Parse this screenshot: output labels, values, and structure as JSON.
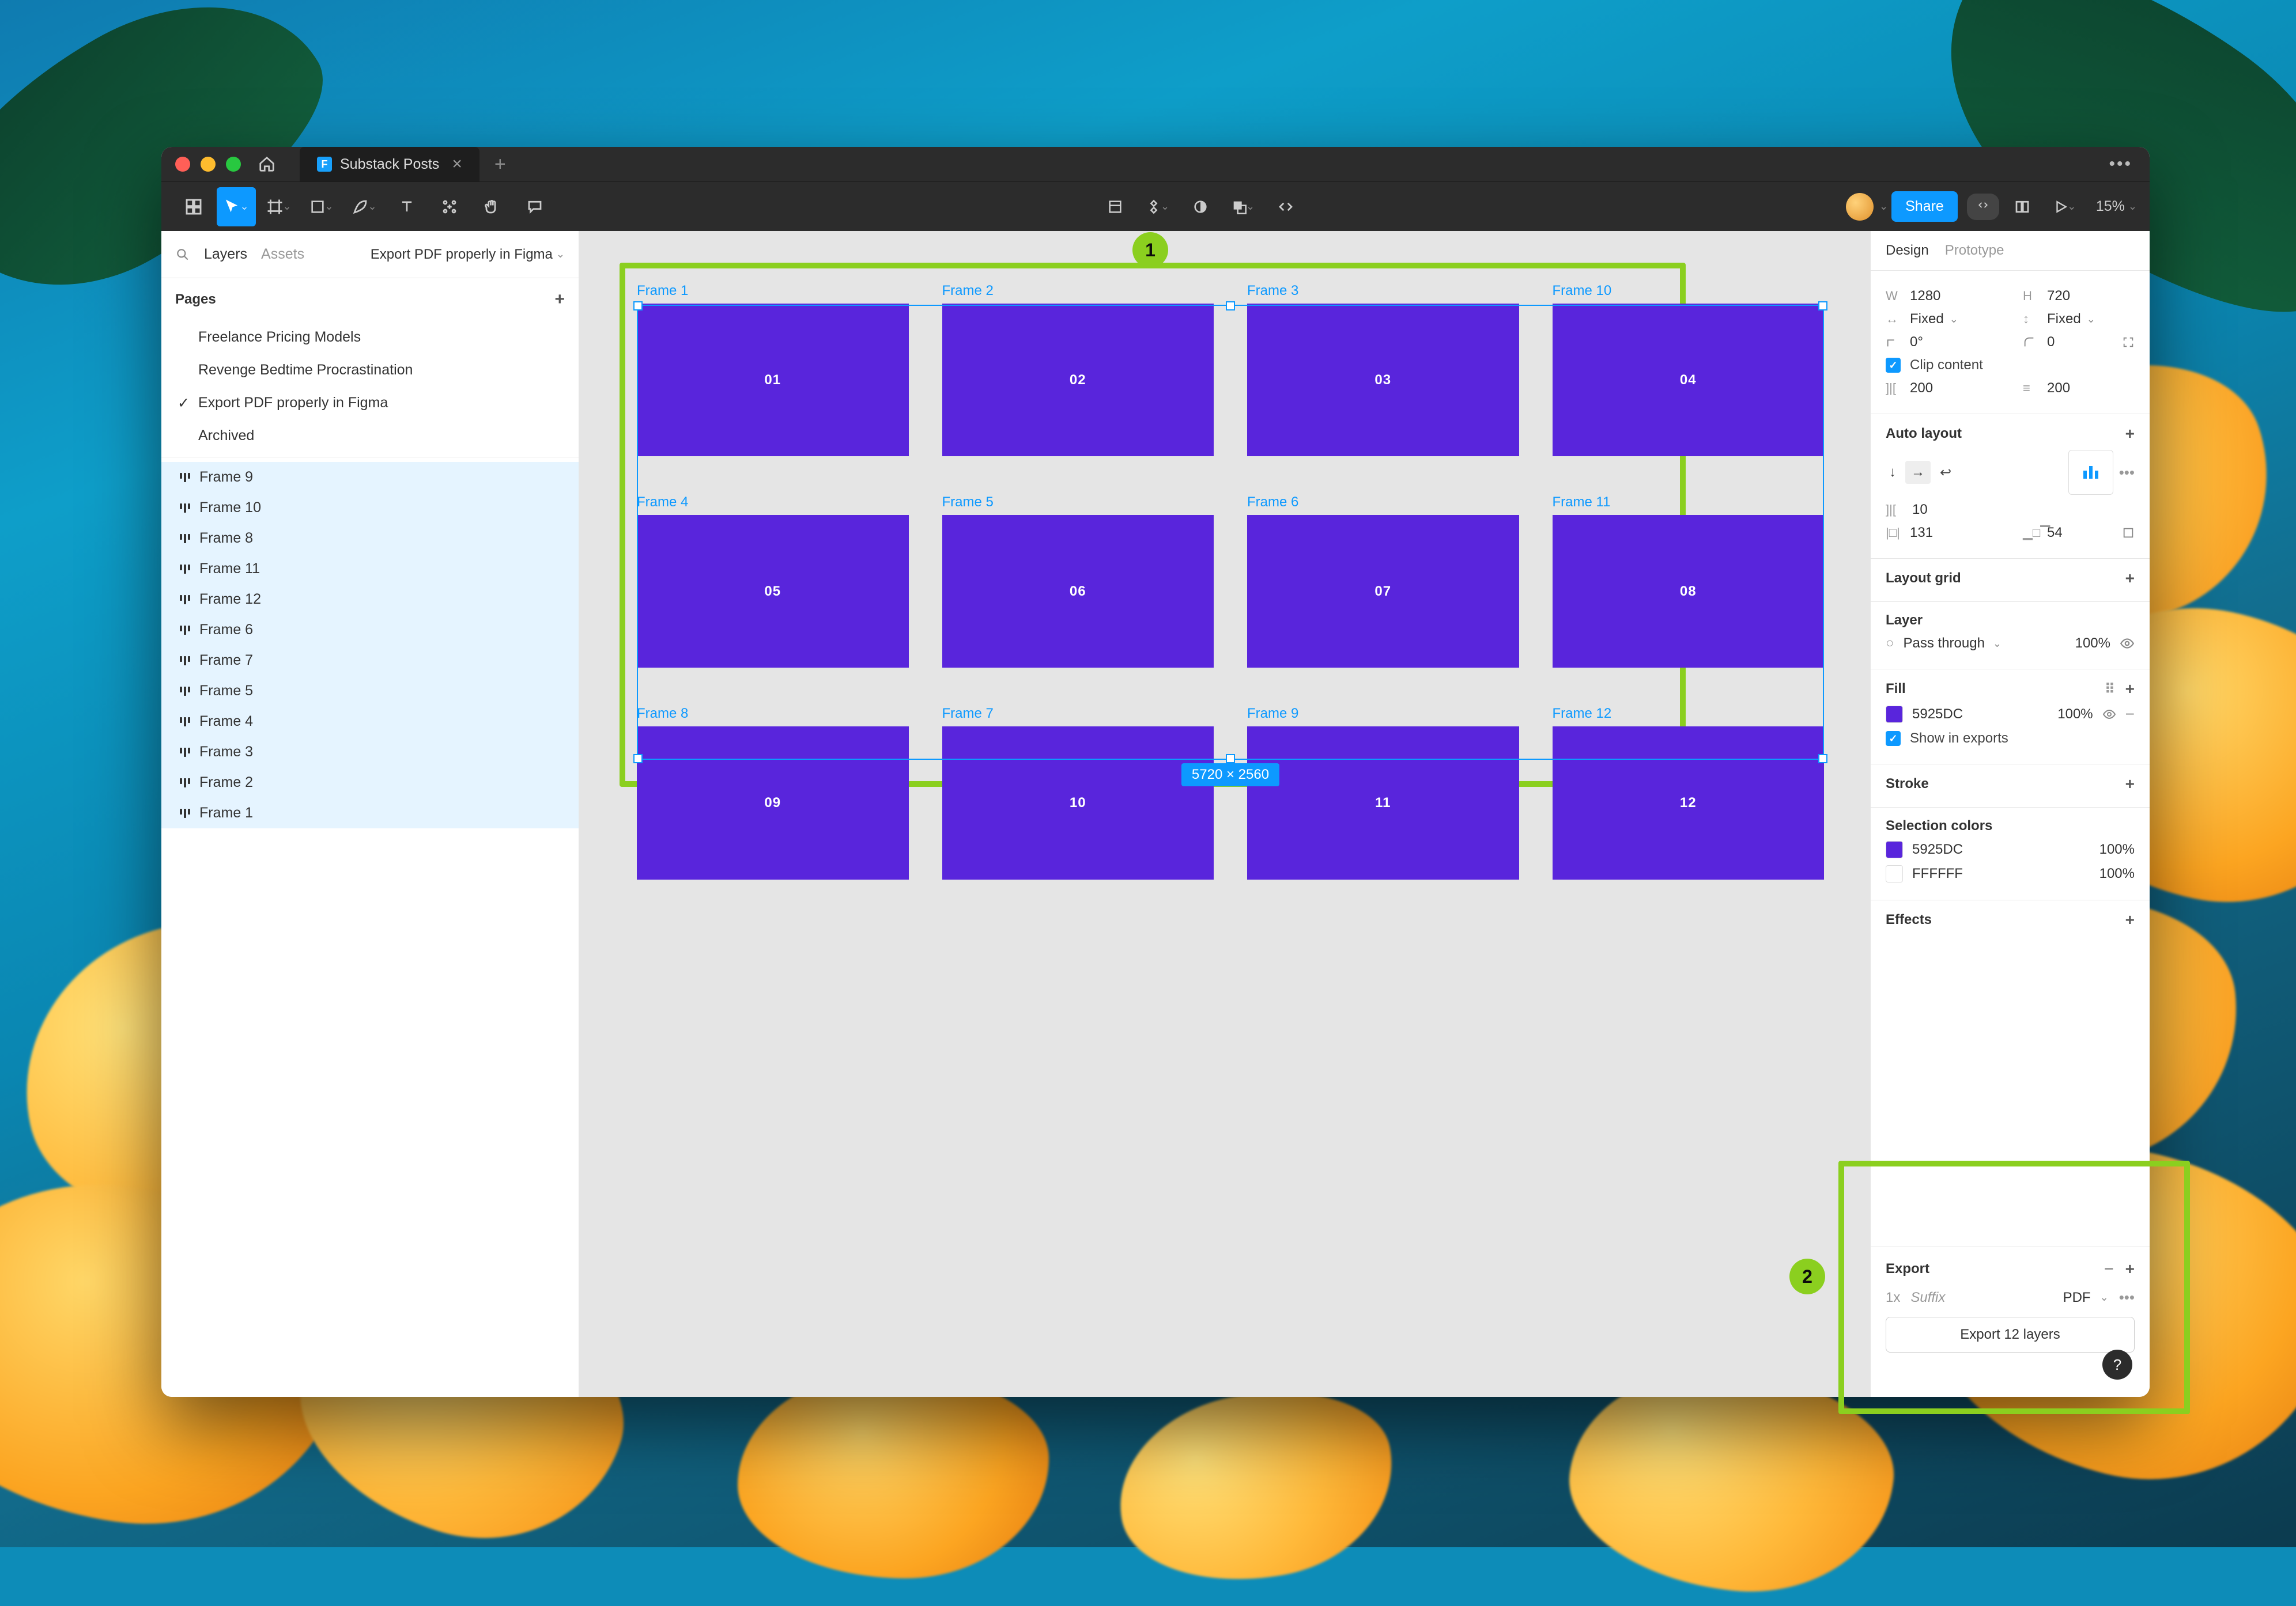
{
  "tab": {
    "title": "Substack Posts"
  },
  "toolbar": {
    "share_label": "Share",
    "zoom": "15%"
  },
  "left_panel": {
    "tab_layers": "Layers",
    "tab_assets": "Assets",
    "file_name": "Export PDF properly in Figma",
    "pages_label": "Pages",
    "pages": [
      {
        "name": "Freelance Pricing Models",
        "selected": false
      },
      {
        "name": "Revenge Bedtime Procrastination",
        "selected": false
      },
      {
        "name": "Export PDF properly in Figma",
        "selected": true
      },
      {
        "name": "Archived",
        "selected": false
      }
    ],
    "layers": [
      {
        "name": "Frame 9",
        "selected": true
      },
      {
        "name": "Frame 10",
        "selected": true
      },
      {
        "name": "Frame 8",
        "selected": true
      },
      {
        "name": "Frame 11",
        "selected": true
      },
      {
        "name": "Frame 12",
        "selected": true
      },
      {
        "name": "Frame 6",
        "selected": true
      },
      {
        "name": "Frame 7",
        "selected": true
      },
      {
        "name": "Frame 5",
        "selected": true
      },
      {
        "name": "Frame 4",
        "selected": true
      },
      {
        "name": "Frame 3",
        "selected": true
      },
      {
        "name": "Frame 2",
        "selected": true
      },
      {
        "name": "Frame 1",
        "selected": true
      }
    ]
  },
  "canvas": {
    "selection_dim": "5720 × 2560",
    "frames": [
      {
        "label": "Frame 1",
        "slide": "01"
      },
      {
        "label": "Frame 2",
        "slide": "02"
      },
      {
        "label": "Frame 3",
        "slide": "03"
      },
      {
        "label": "Frame 10",
        "slide": "04"
      },
      {
        "label": "Frame 4",
        "slide": "05"
      },
      {
        "label": "Frame 5",
        "slide": "06"
      },
      {
        "label": "Frame 6",
        "slide": "07"
      },
      {
        "label": "Frame 11",
        "slide": "08"
      },
      {
        "label": "Frame 8",
        "slide": "09"
      },
      {
        "label": "Frame 7",
        "slide": "10"
      },
      {
        "label": "Frame 9",
        "slide": "11"
      },
      {
        "label": "Frame 12",
        "slide": "12"
      }
    ],
    "annotations": {
      "badge1": "1",
      "badge2": "2"
    }
  },
  "right_panel": {
    "tab_design": "Design",
    "tab_prototype": "Prototype",
    "dimensions": {
      "w_label": "W",
      "w": "1280",
      "h_label": "H",
      "h": "720"
    },
    "constraints": {
      "h_mode": "Fixed",
      "v_mode": "Fixed"
    },
    "rotation": {
      "angle_label": "",
      "angle": "0°",
      "radius_label": "",
      "radius": "0"
    },
    "clip_content": "Clip content",
    "gap": {
      "h_label": "",
      "h": "200",
      "v_label": "",
      "v": "200"
    },
    "auto_layout": {
      "title": "Auto layout",
      "gap": "10",
      "padding_h": "131",
      "padding_v": "54"
    },
    "layout_grid": {
      "title": "Layout grid"
    },
    "layer": {
      "title": "Layer",
      "blend": "Pass through",
      "opacity": "100%"
    },
    "fill": {
      "title": "Fill",
      "color": "5925DC",
      "opacity": "100%",
      "show_exports": "Show in exports"
    },
    "stroke": {
      "title": "Stroke"
    },
    "selection_colors": {
      "title": "Selection colors",
      "rows": [
        {
          "hex": "5925DC",
          "pct": "100%"
        },
        {
          "hex": "FFFFFF",
          "pct": "100%"
        }
      ]
    },
    "effects": {
      "title": "Effects"
    },
    "export": {
      "title": "Export",
      "scale": "1x",
      "suffix_placeholder": "Suffix",
      "format": "PDF",
      "button": "Export 12 layers"
    }
  }
}
